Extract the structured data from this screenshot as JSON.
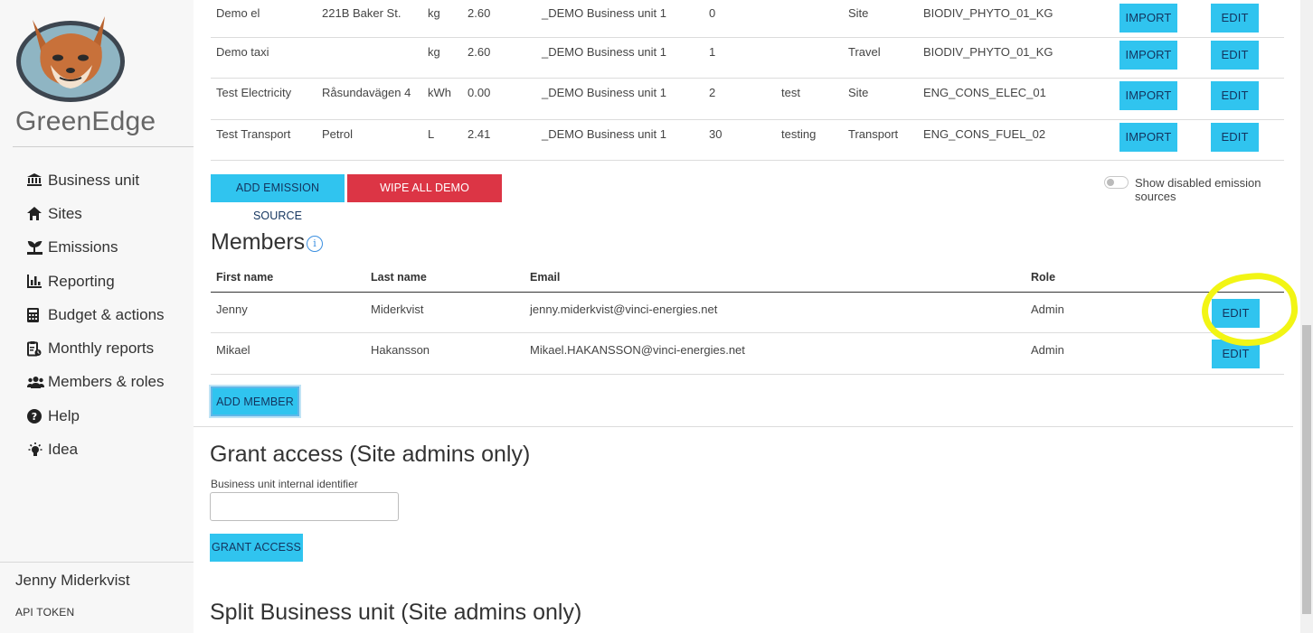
{
  "app": {
    "name": "GreenEdge",
    "logo_icon": "fox-mascot-logo-icon"
  },
  "sidebar": {
    "items": [
      {
        "label": "Business unit",
        "icon": "bank-icon"
      },
      {
        "label": "Sites",
        "icon": "home-icon"
      },
      {
        "label": "Emissions",
        "icon": "emissions-icon"
      },
      {
        "label": "Reporting",
        "icon": "bar-chart-icon"
      },
      {
        "label": "Budget & actions",
        "icon": "calculator-icon"
      },
      {
        "label": "Monthly reports",
        "icon": "report-icon"
      },
      {
        "label": "Members & roles",
        "icon": "users-icon"
      },
      {
        "label": "Help",
        "icon": "question-circle-icon"
      },
      {
        "label": "Idea",
        "icon": "lightbulb-icon"
      }
    ],
    "user_name": "Jenny Miderkvist",
    "api_token_label": "API TOKEN"
  },
  "emissions": {
    "rows": [
      {
        "name": "Demo el",
        "detail": "221B Baker St.",
        "unit": "kg",
        "factor": "2.60",
        "business_unit": "_DEMO Business unit 1",
        "count": "0",
        "note": "",
        "category": "Site",
        "code": "BIODIV_PHYTO_01_KG",
        "import_label": "IMPORT",
        "edit_label": "EDIT"
      },
      {
        "name": "Demo taxi",
        "detail": "",
        "unit": "kg",
        "factor": "2.60",
        "business_unit": "_DEMO Business unit 1",
        "count": "1",
        "note": "",
        "category": "Travel",
        "code": "BIODIV_PHYTO_01_KG",
        "import_label": "IMPORT",
        "edit_label": "EDIT"
      },
      {
        "name": "Test Electricity",
        "detail": "Råsundavägen 4",
        "unit": "kWh",
        "factor": "0.00",
        "business_unit": "_DEMO Business unit 1",
        "count": "2",
        "note": "test",
        "category": "Site",
        "code": "ENG_CONS_ELEC_01",
        "import_label": "IMPORT",
        "edit_label": "EDIT"
      },
      {
        "name": "Test Transport",
        "detail": "Petrol",
        "unit": "L",
        "factor": "2.41",
        "business_unit": "_DEMO Business unit 1",
        "count": "30",
        "note": "testing",
        "category": "Transport",
        "code": "ENG_CONS_FUEL_02",
        "import_label": "IMPORT",
        "edit_label": "EDIT"
      }
    ],
    "add_label": "ADD EMISSION SOURCE",
    "wipe_label": "WIPE ALL DEMO EMISSIONS",
    "toggle_label": "Show disabled emission sources",
    "toggle_on": false
  },
  "members": {
    "title": "Members",
    "headers": {
      "first": "First name",
      "last": "Last name",
      "email": "Email",
      "role": "Role"
    },
    "rows": [
      {
        "first": "Jenny",
        "last": "Miderkvist",
        "email": "jenny.miderkvist@vinci-energies.net",
        "role": "Admin",
        "edit_label": "EDIT"
      },
      {
        "first": "Mikael",
        "last": "Hakansson",
        "email": "Mikael.HAKANSSON@vinci-energies.net",
        "role": "Admin",
        "edit_label": "EDIT"
      }
    ],
    "add_label": "ADD MEMBER",
    "highlight_color": "#f2f514"
  },
  "grant": {
    "title": "Grant access (Site admins only)",
    "field_label": "Business unit internal identifier",
    "field_value": "",
    "button_label": "GRANT ACCESS"
  },
  "split": {
    "title": "Split Business unit (Site admins only)"
  },
  "colors": {
    "accent": "#30c4ef",
    "danger": "#dc3545",
    "sidebar_bg": "#f7f7f7"
  }
}
